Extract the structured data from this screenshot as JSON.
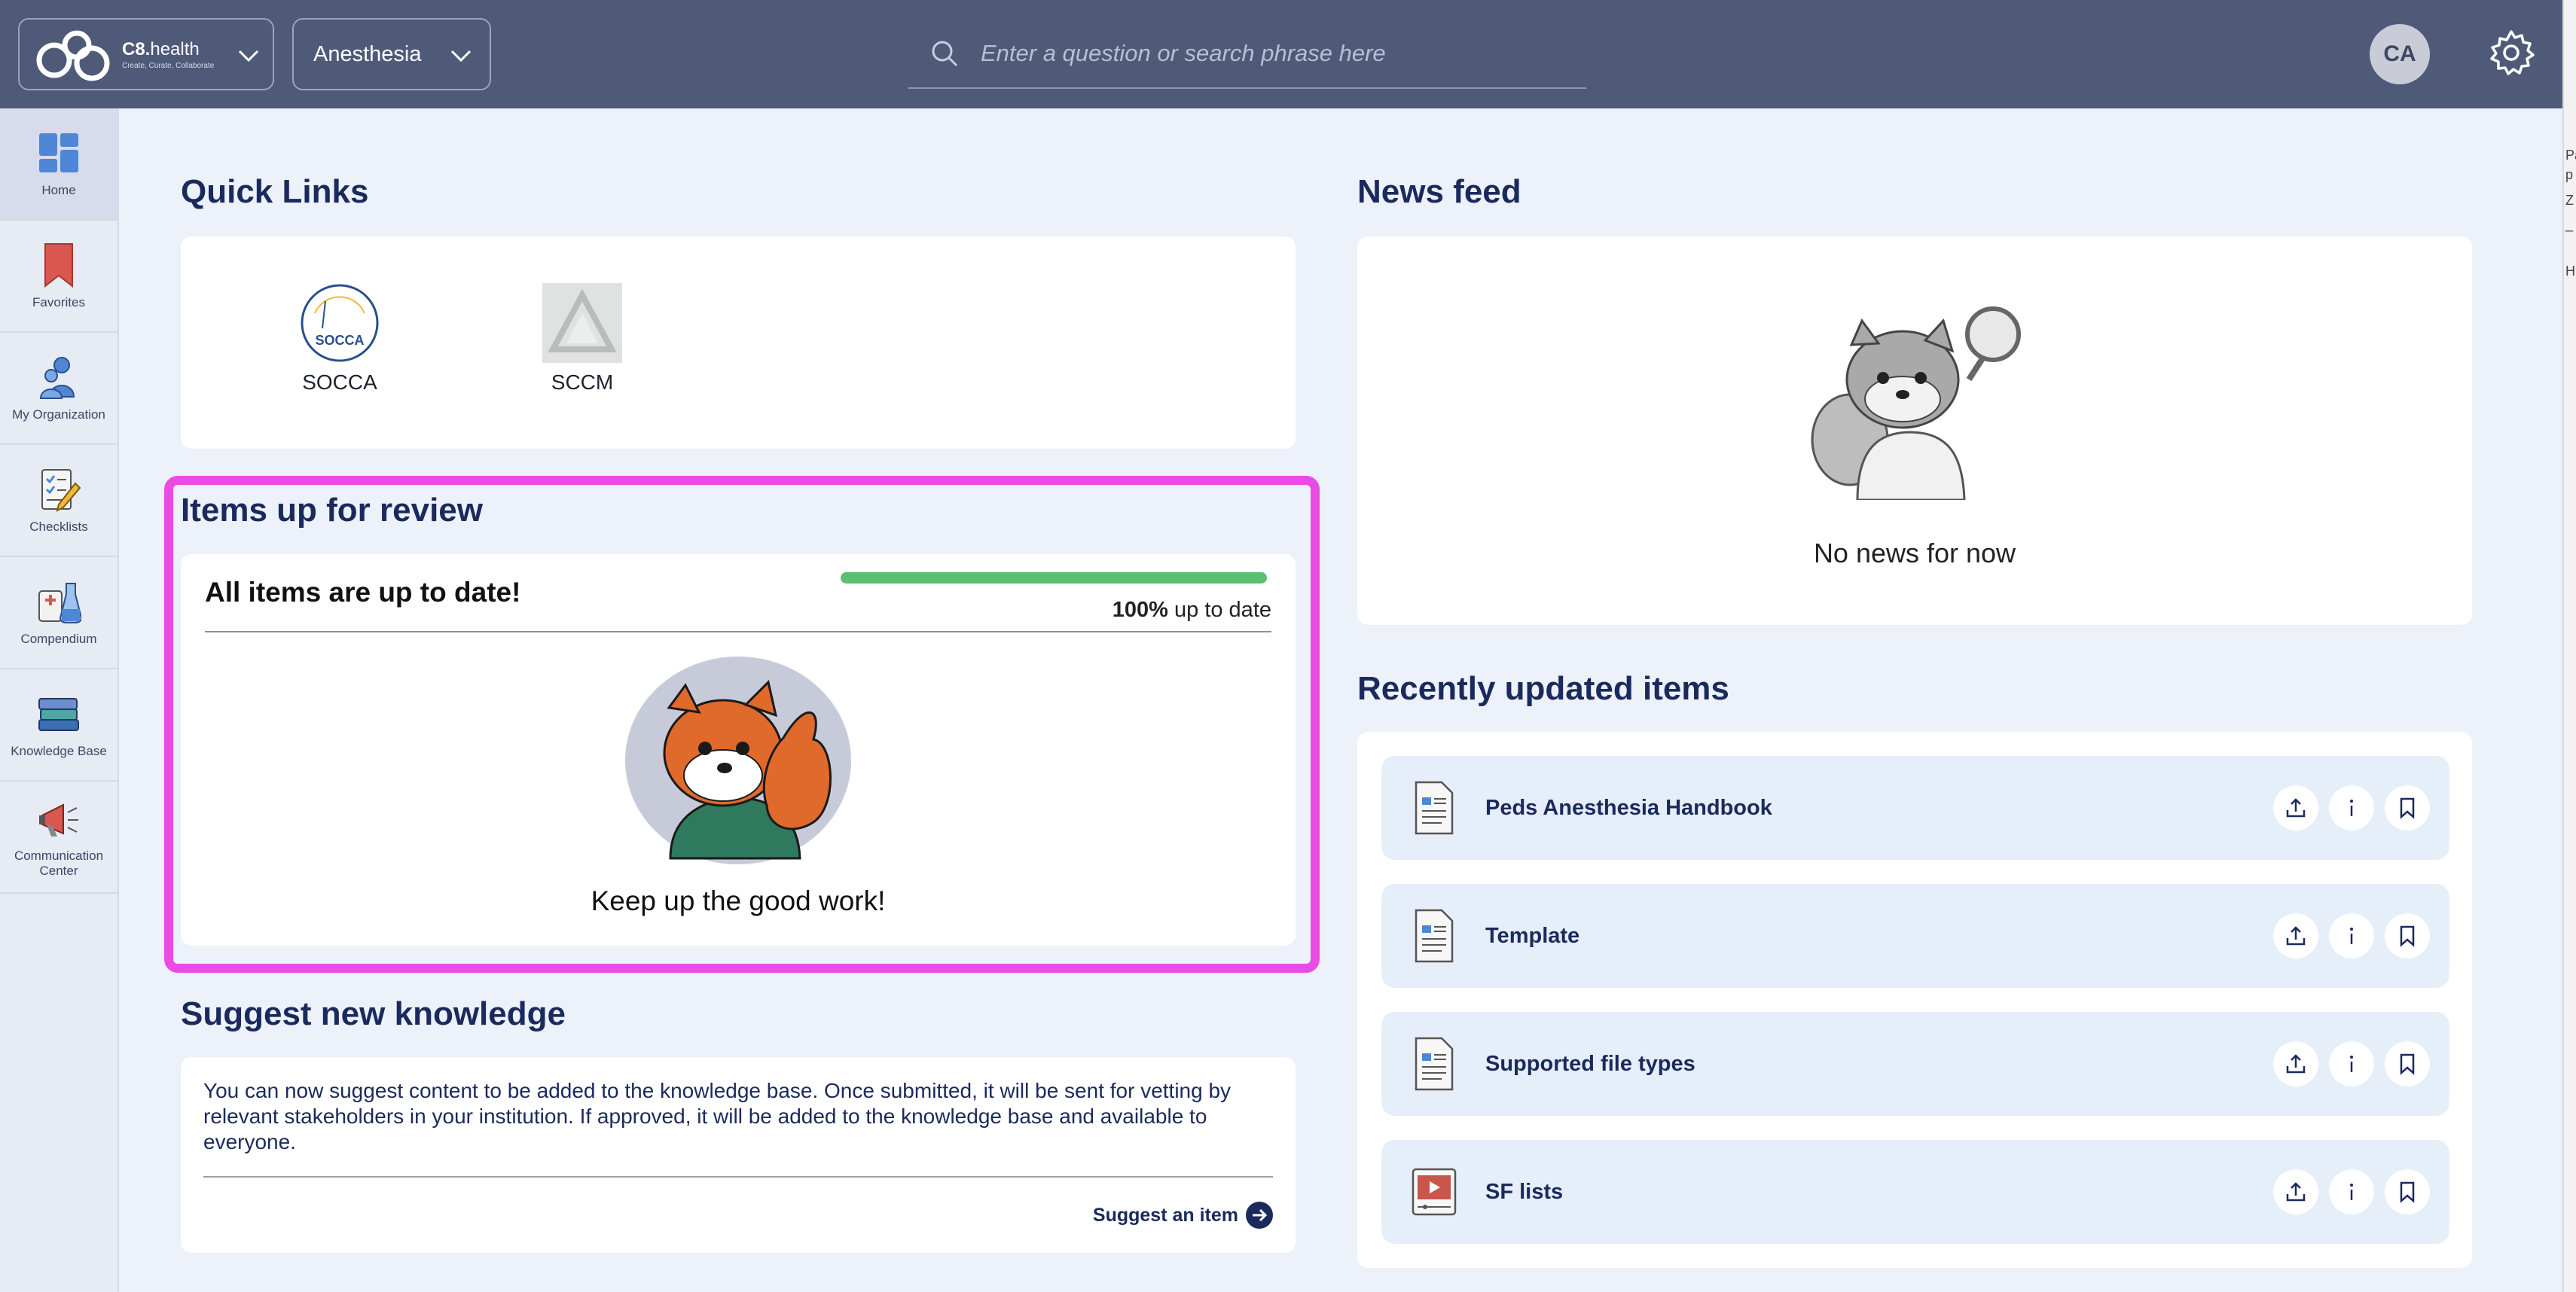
{
  "header": {
    "brand_name": "C8.",
    "brand_suffix": "health",
    "brand_tagline": "Create, Curate, Collaborate",
    "department": "Anesthesia",
    "search_placeholder": "Enter a question or search phrase here",
    "avatar_initials": "CA"
  },
  "sidebar": {
    "items": [
      {
        "label": "Home",
        "icon": "grid-icon"
      },
      {
        "label": "Favorites",
        "icon": "bookmark-icon"
      },
      {
        "label": "My Organization",
        "icon": "people-icon"
      },
      {
        "label": "Checklists",
        "icon": "checklist-icon"
      },
      {
        "label": "Compendium",
        "icon": "flask-icon"
      },
      {
        "label": "Knowledge Base",
        "icon": "books-icon"
      },
      {
        "label": "Communication Center",
        "icon": "megaphone-icon"
      }
    ]
  },
  "quick_links": {
    "title": "Quick Links",
    "items": [
      {
        "label": "SOCCA",
        "logo_text": "SOCCA"
      },
      {
        "label": "SCCM"
      }
    ]
  },
  "review": {
    "title": "Items up for review",
    "status": "All items are up to date!",
    "percent": "100%",
    "percent_value": 100,
    "percent_suffix": "up to date",
    "message": "Keep up the good work!"
  },
  "suggest": {
    "title": "Suggest new knowledge",
    "text": "You can now suggest content to be added to the knowledge base. Once submitted, it will be sent for vetting by relevant stakeholders in your institution. If approved, it will be added to the knowledge base and available to everyone.",
    "link": "Suggest an item"
  },
  "news": {
    "title": "News feed",
    "empty": "No news for now"
  },
  "recent": {
    "title": "Recently updated items",
    "items": [
      {
        "title": "Peds Anesthesia Handbook",
        "icon": "document-icon"
      },
      {
        "title": "Template",
        "icon": "document-icon"
      },
      {
        "title": "Supported file types",
        "icon": "document-icon"
      },
      {
        "title": "SF lists",
        "icon": "video-icon"
      }
    ]
  },
  "colors": {
    "topbar": "#4f5a79",
    "accent_navy": "#1b2a5c",
    "highlight": "#ea4be5",
    "progress": "#5cbf6d"
  },
  "edge_fragments": [
    "Pa",
    "p",
    "Z",
    "_",
    "H"
  ]
}
